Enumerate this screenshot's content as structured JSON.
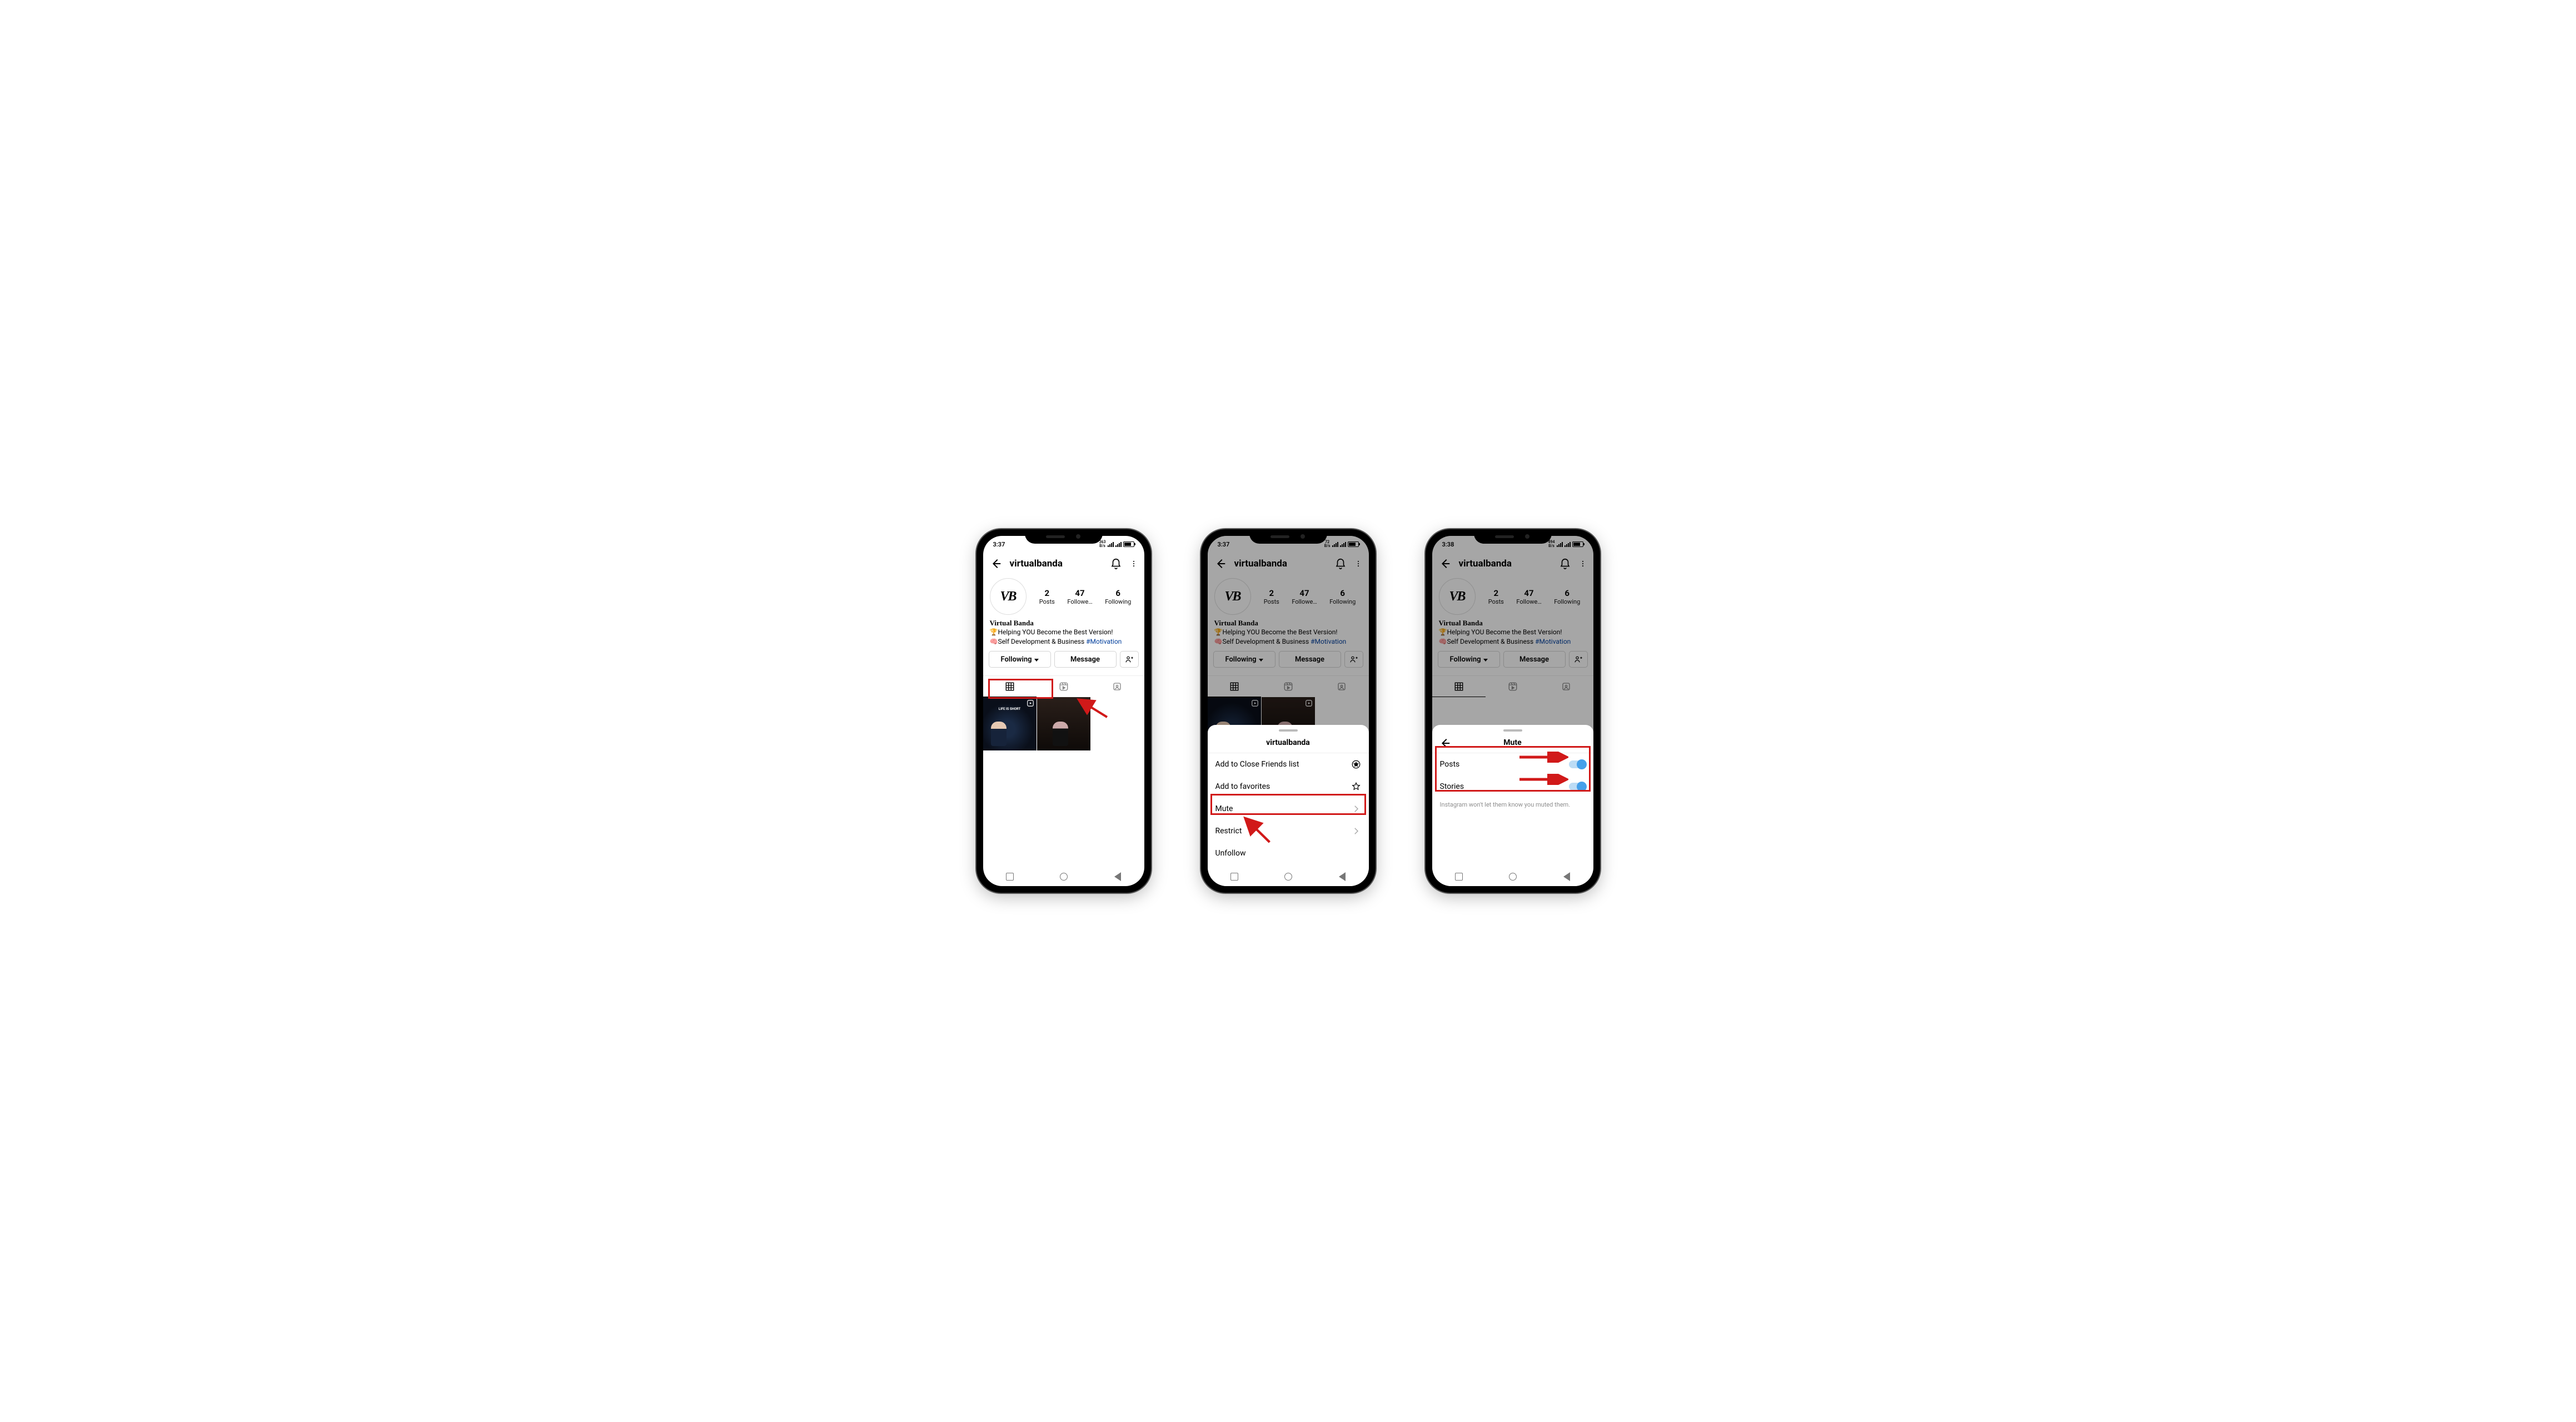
{
  "status": {
    "time1": "3:37",
    "time2": "3:37",
    "time3": "3:38",
    "net1": "363",
    "net2": "72",
    "net3": "494",
    "net_unit": "B/s"
  },
  "header": {
    "username": "virtualbanda",
    "avatar_text": "VB"
  },
  "stats": {
    "posts_n": "2",
    "posts_l": "Posts",
    "followers_n": "47",
    "followers_l": "Followe…",
    "following_n": "6",
    "following_l": "Following"
  },
  "bio": {
    "display_name": "Virtual Banda",
    "line1_pre": "🏆Helping YOU Become the Best Version!",
    "line2_pre": "🧠Self Development & Business ",
    "hashtag": "#Motivation"
  },
  "buttons": {
    "following": "Following",
    "message": "Message"
  },
  "thumb1_caption": "LIFE IS SHORT",
  "sheet_following": {
    "title": "virtualbanda",
    "close_friends": "Add to Close Friends list",
    "favorites": "Add to favorites",
    "mute": "Mute",
    "restrict": "Restrict",
    "unfollow": "Unfollow"
  },
  "sheet_mute": {
    "title": "Mute",
    "posts": "Posts",
    "stories": "Stories",
    "note": "Instagram won't let them know you muted them."
  }
}
